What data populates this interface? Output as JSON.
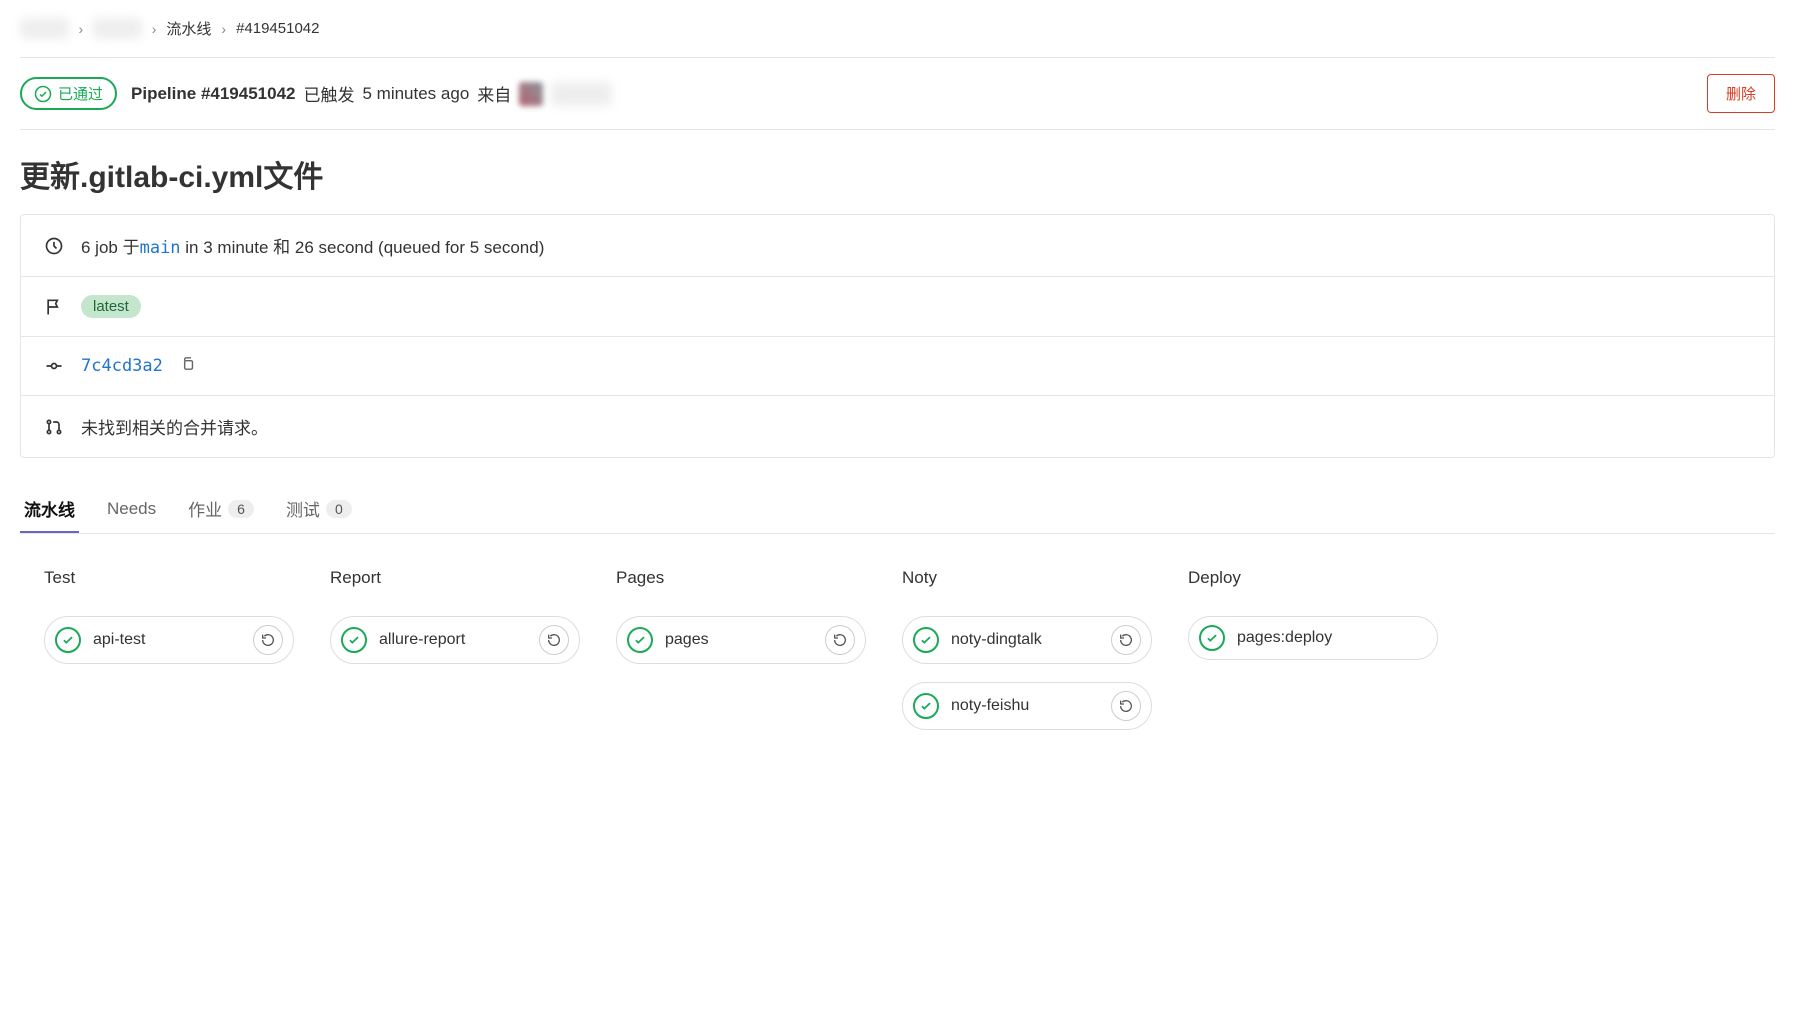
{
  "breadcrumb": {
    "pipeline_label": "流水线",
    "pipeline_id": "#419451042"
  },
  "header": {
    "status": "已通过",
    "pipeline_prefix": "Pipeline",
    "pipeline_number": "#419451042",
    "triggered_text": "已触发",
    "time_ago": "5 minutes ago",
    "from_text": "来自",
    "delete_btn": "删除"
  },
  "title": "更新.gitlab-ci.yml文件",
  "info": {
    "jobs_prefix": "6 job 于",
    "branch": "main",
    "duration_text": " in 3 minute 和 26 second (queued for 5 second)",
    "latest_tag": "latest",
    "commit_sha": "7c4cd3a2",
    "merge_request_text": "未找到相关的合并请求。"
  },
  "tabs": {
    "pipeline": "流水线",
    "needs": "Needs",
    "jobs": "作业",
    "jobs_count": "6",
    "tests": "测试",
    "tests_count": "0"
  },
  "graph": {
    "stages": [
      {
        "name": "Test",
        "jobs": [
          {
            "name": "api-test",
            "retry": true
          }
        ]
      },
      {
        "name": "Report",
        "jobs": [
          {
            "name": "allure-report",
            "retry": true
          }
        ]
      },
      {
        "name": "Pages",
        "jobs": [
          {
            "name": "pages",
            "retry": true
          }
        ]
      },
      {
        "name": "Noty",
        "jobs": [
          {
            "name": "noty-dingtalk",
            "retry": true
          },
          {
            "name": "noty-feishu",
            "retry": true
          }
        ]
      },
      {
        "name": "Deploy",
        "jobs": [
          {
            "name": "pages:deploy",
            "retry": false
          }
        ]
      }
    ]
  }
}
